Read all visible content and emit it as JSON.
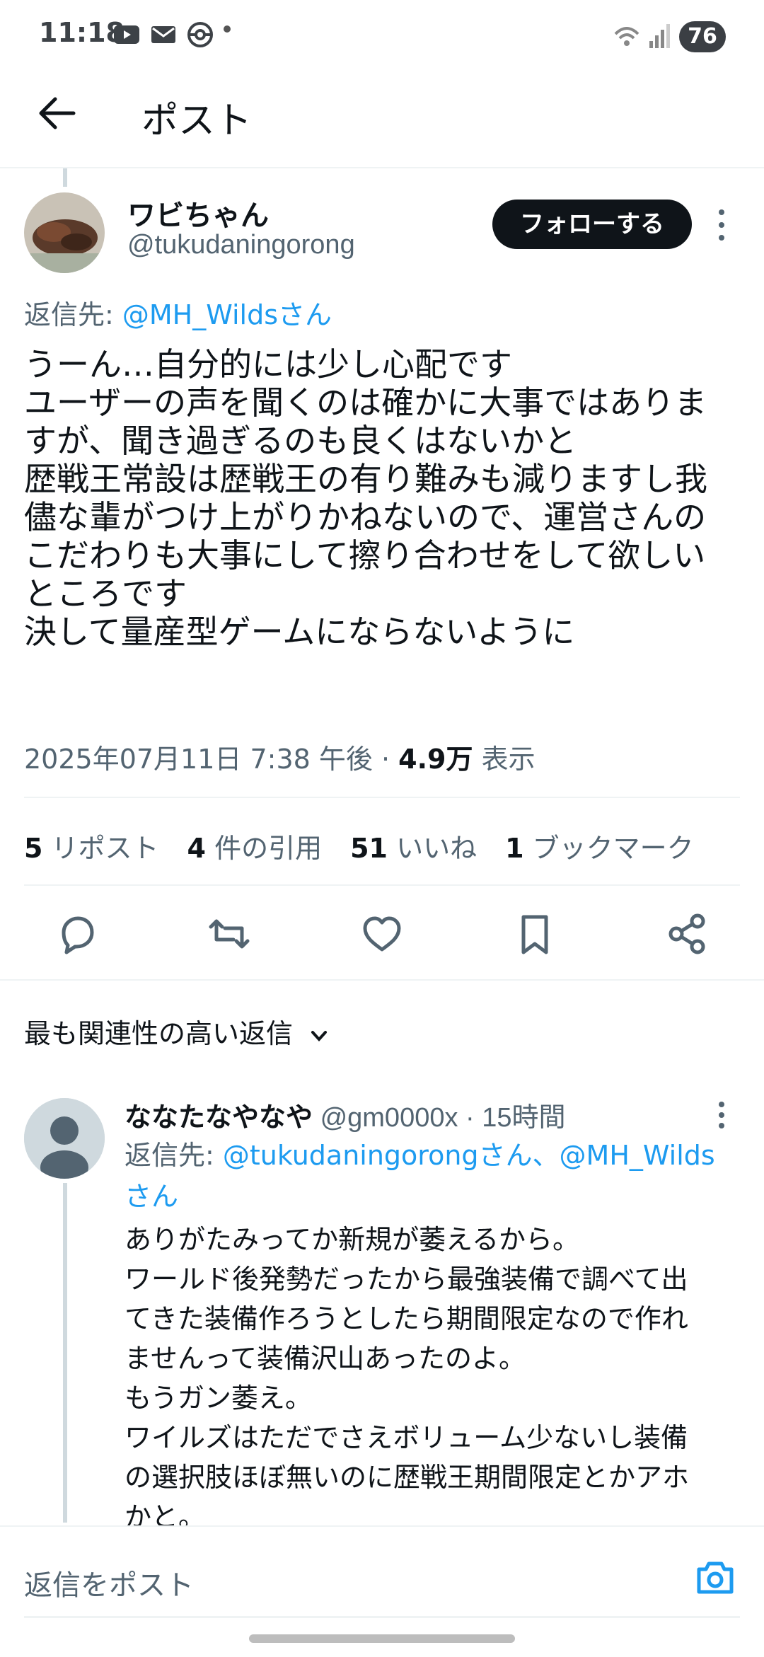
{
  "status_bar": {
    "time": "11:18",
    "battery": "76"
  },
  "header": {
    "title": "ポスト"
  },
  "post": {
    "display_name": "ワビちゃん",
    "handle": "@tukudaningorong",
    "follow_label": "フォローする",
    "reply_to_prefix": "返信先: ",
    "reply_to_user": "@MH_Wildsさん",
    "body": "うーん…自分的には少し心配です\nユーザーの声を聞くのは確かに大事ではありま\nすが、聞き過ぎるのも良くはないかと\n歴戦王常設は歴戦王の有り難みも減りますし我\n儘な輩がつけ上がりかねないので、運営さんの\nこだわりも大事にして擦り合わせをして欲しい\nところです\n決して量産型ゲームにならないように",
    "timestamp": "2025年07月11日 7:38 午後 · ",
    "views_count": "4.9万",
    "views_label": " 表示",
    "stats": {
      "reposts_count": "5",
      "reposts_label": " リポスト",
      "quotes_count": "4",
      "quotes_label": " 件の引用",
      "likes_count": "51",
      "likes_label": " いいね",
      "bookmarks_count": "1",
      "bookmarks_label": " ブックマーク"
    }
  },
  "replies_section": {
    "sort_label": "最も関連性の高い返信"
  },
  "reply": {
    "display_name": "ななたなやなや",
    "handle": " @gm0000x",
    "time": " · 15時間",
    "reply_to_prefix": "返信先: ",
    "reply_to_users": "@tukudaningorongさん、@MH_Wildsさん",
    "body": "ありがたみってか新規が萎えるから。\nワールド後発勢だったから最強装備で調べて出\nてきた装備作ろうとしたら期間限定なので作れ\nませんって装備沢山あったのよ。\nもうガン萎え。\nワイルズはただでさえボリューム少ないし装備\nの選択肢ほぼ無いのに歴戦王期間限定とかアホ\nかと。"
  },
  "compose": {
    "placeholder": "返信をポスト"
  },
  "colors": {
    "accent": "#1d9bf0",
    "text_primary": "#0f1419",
    "text_secondary": "#536471"
  }
}
